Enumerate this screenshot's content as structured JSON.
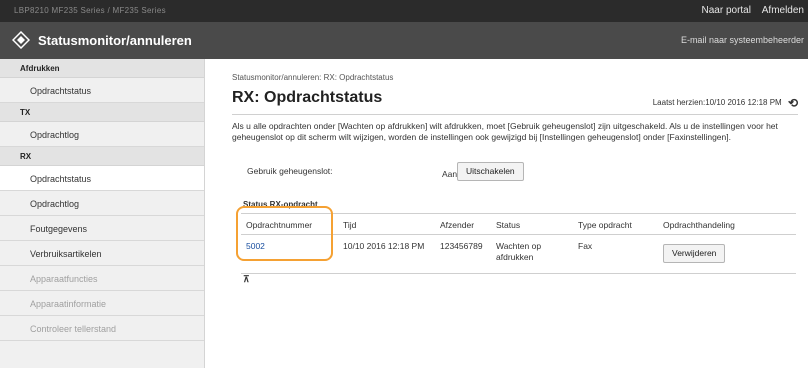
{
  "topbar": {
    "device_text": "LBP8210  MF235 Series / MF235 Series",
    "portal_link": "Naar portal",
    "logout_link": "Afmelden"
  },
  "header": {
    "title": "Statusmonitor/annuleren",
    "mail_link": "E-mail naar systeembeheerder"
  },
  "sidebar": {
    "sections": [
      {
        "label": "Afdrukken",
        "items": [
          {
            "label": "Opdrachtstatus",
            "state": "normal"
          }
        ]
      },
      {
        "label": "TX",
        "items": [
          {
            "label": "Opdrachtlog",
            "state": "normal"
          }
        ]
      },
      {
        "label": "RX",
        "items": [
          {
            "label": "Opdrachtstatus",
            "state": "active"
          },
          {
            "label": "Opdrachtlog",
            "state": "normal"
          },
          {
            "label": "Foutgegevens",
            "state": "normal"
          },
          {
            "label": "Verbruiksartikelen",
            "state": "normal"
          },
          {
            "label": "Apparaatfuncties",
            "state": "dim"
          },
          {
            "label": "Apparaatinformatie",
            "state": "dim"
          },
          {
            "label": "Controleer tellerstand",
            "state": "dim"
          }
        ]
      }
    ]
  },
  "main": {
    "breadcrumb": "Statusmonitor/annuleren: RX: Opdrachtstatus",
    "title": "RX: Opdrachtstatus",
    "last_updated": "Laatst herzien:10/10 2016 12:18 PM",
    "description": "Als u alle opdrachten onder [Wachten op afdrukken] wilt afdrukken, moet [Gebruik geheugenslot] zijn uitgeschakeld. Als u de instellingen voor het geheugenslot op dit scherm wilt wijzigen, worden de instellingen ook gewijzigd bij [Instellingen geheugenslot] onder [Faxinstellingen].",
    "memory_lock": {
      "label": "Gebruik geheugenslot:",
      "value": "Aan",
      "button": "Uitschakelen"
    },
    "section_title": "Status RX-opdracht",
    "table": {
      "headers": [
        "Opdrachtnummer",
        "Tijd",
        "Afzender",
        "Status",
        "Type opdracht",
        "Opdrachthandeling"
      ],
      "rows": [
        {
          "number": "5002",
          "time": "10/10 2016 12:18 PM",
          "sender": "123456789",
          "status": "Wachten op afdrukken",
          "type": "Fax",
          "action": "Verwijderen"
        }
      ]
    },
    "to_top": "⊼"
  },
  "colors": {
    "highlight": "#f5a133",
    "topbar": "#2b2b2b",
    "titlebar": "#4a4a4a",
    "link": "#1a4fa0"
  },
  "icons": {
    "logo": "diamond-logo-icon",
    "refresh": "refresh-arrows-icon",
    "to_top": "scroll-to-top-icon"
  }
}
